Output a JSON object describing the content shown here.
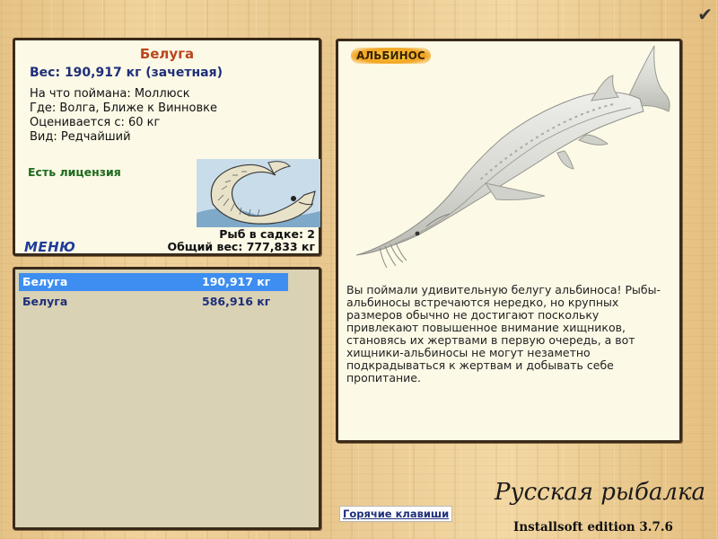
{
  "info": {
    "fish_name": "Белуга",
    "weight": "Вес: 190,917 кг (зачетная)",
    "caught_on": "На что поймана: Моллюск",
    "location": "Где: Волга, Ближе к Винновке",
    "value": "Оценивается с: 60 кг",
    "kind": "Вид: Редчайший",
    "license": "Есть лицензия",
    "menu": "МЕНЮ",
    "fish_in_keepnet": "Рыб в садке: 2",
    "total_weight": "Общий вес: 777,833 кг"
  },
  "catch_list": [
    {
      "name": "Белуга",
      "weight": "190,917 кг",
      "selected": true
    },
    {
      "name": "Белуга",
      "weight": "586,916 кг",
      "selected": false
    }
  ],
  "fish_panel": {
    "badge": "АЛЬБИНОС",
    "description": "Вы поймали удивительную белугу альбиноса! Рыбы-альбиносы встречаются нередко, но крупных размеров обычно не достигают поскольку привлекают повышенное внимание хищников, становясь их жертвами в первую очередь, а вот хищники-альбиносы не могут незаметно подкрадываться к жертвам и добывать себе пропитание."
  },
  "footer": {
    "hotkeys": "Горячие клавиши",
    "game_title": "Русская рыбалка",
    "edition": "Installsoft edition 3.7.6"
  },
  "icons": {
    "close": "checkmark-icon"
  },
  "colors": {
    "fish_name": "#b8471d",
    "weight": "#1e2f7a",
    "license": "#1d6a1d",
    "selected_row": "#3d8ef0"
  }
}
